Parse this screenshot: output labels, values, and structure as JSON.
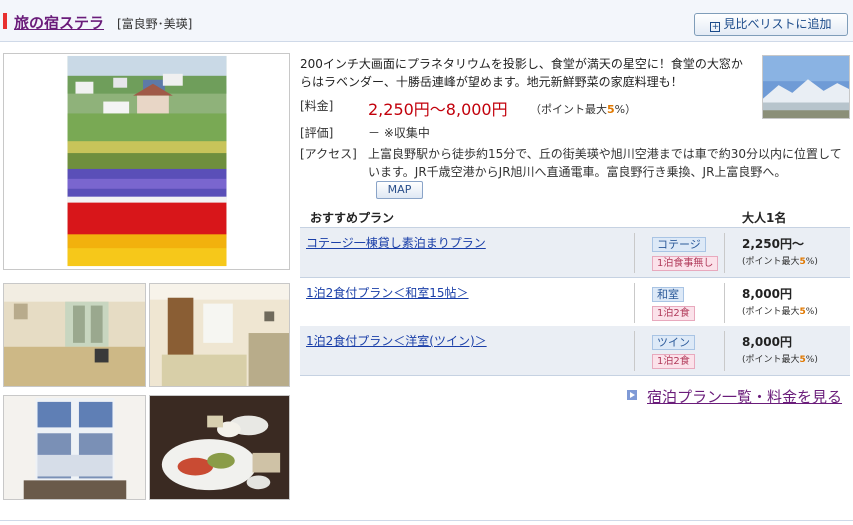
{
  "header": {
    "hotel_name": "旅の宿ステラ",
    "area": "[富良野･美瑛]",
    "compare_label": "見比べリストに追加"
  },
  "description": "200インチ大画面にプラネタリウムを投影し、食堂が満天の星空に！食堂の大窓からはラベンダー、十勝岳連峰が望めます。地元新鮮野菜の家庭料理も！",
  "info": {
    "price_label": "[料金]",
    "price_range": "2,250円～8,000円",
    "price_points_prefix": "（ポイント最大",
    "price_points_value": "5",
    "price_points_suffix": "%）",
    "rating_label": "[評価]",
    "rating_value": "－ ※収集中",
    "access_label": "[アクセス]",
    "access_text": "上富良野駅から徒歩約15分で、丘の街美瑛や旭川空港までは車で約30分以内に位置しています。JR千歳空港からJR旭川へ直通電車。富良野行き乗換、JR上富良野へ。",
    "map_label": "MAP"
  },
  "plans": {
    "header_plan": "おすすめプラン",
    "header_price": "大人1名",
    "items": [
      {
        "name": "コテージ一棟貸し素泊まりプラン",
        "room": "コテージ",
        "meal": "1泊食事無し",
        "price": "2,250円～",
        "pt_prefix": "(ポイント最大",
        "pt_value": "5",
        "pt_suffix": "%)"
      },
      {
        "name": "1泊2食付プラン＜和室15帖＞",
        "room": "和室",
        "meal": "1泊2食",
        "price": "8,000円",
        "pt_prefix": "(ポイント最大",
        "pt_value": "5",
        "pt_suffix": "%)"
      },
      {
        "name": "1泊2食付プラン＜洋室(ツイン)＞",
        "room": "ツイン",
        "meal": "1泊2食",
        "price": "8,000円",
        "pt_prefix": "(ポイント最大",
        "pt_value": "5",
        "pt_suffix": "%)"
      }
    ]
  },
  "more_link": "宿泊プラン一覧・料金を見る",
  "colors": {
    "accent_red": "#e8302f",
    "price_red": "#c2000b",
    "link_purple": "#6a1c7a",
    "link_blue": "#1a3fa8",
    "points_orange": "#e07800"
  },
  "photos": [
    {
      "name": "flower-field-photo"
    },
    {
      "name": "japanese-room-photo"
    },
    {
      "name": "western-room-photo"
    },
    {
      "name": "dining-window-photo"
    },
    {
      "name": "meal-photo"
    },
    {
      "name": "mountain-photo"
    }
  ]
}
